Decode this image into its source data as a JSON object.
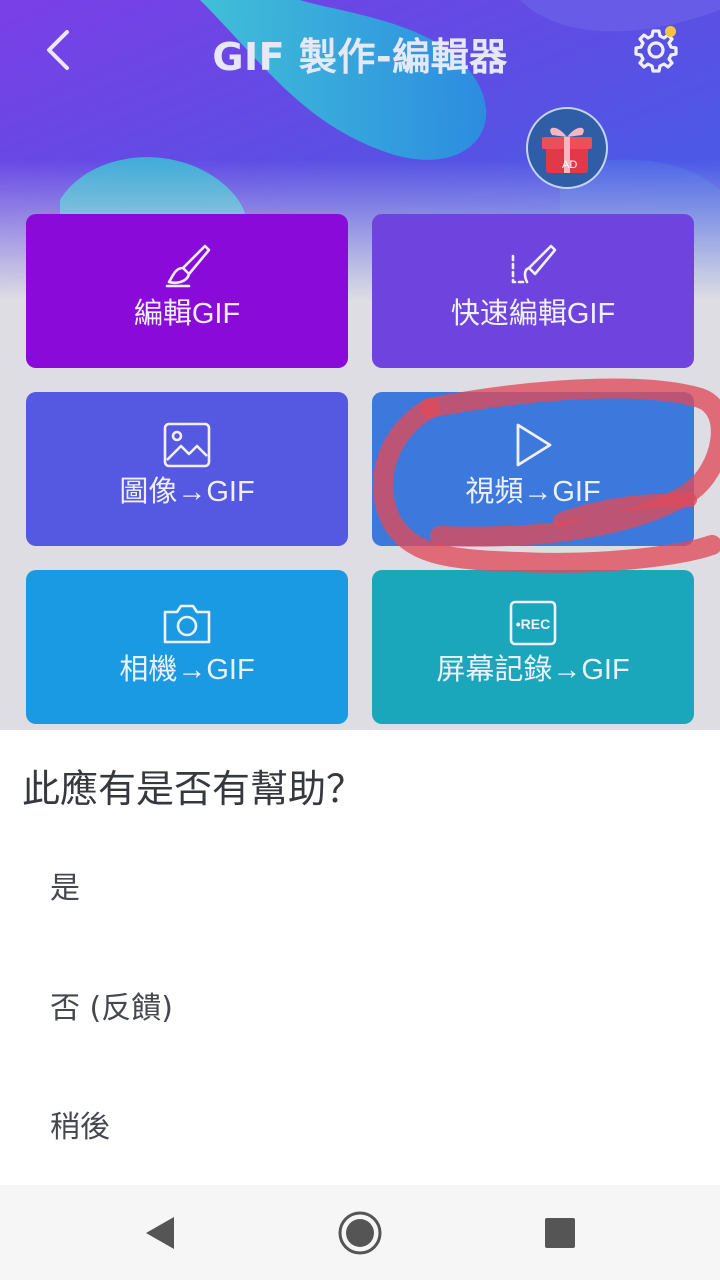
{
  "header": {
    "title": "GIF 製作-編輯器",
    "back_icon": "chevron-left-icon",
    "settings_icon": "gear-icon",
    "ad_icon": "gift-box-icon",
    "ad_badge": "AD"
  },
  "tiles": [
    {
      "label": "編輯GIF",
      "icon": "brush-icon",
      "color": "#8a0ad9"
    },
    {
      "label": "快速編輯GIF",
      "icon": "quick-brush-icon",
      "color": "#6f44de"
    },
    {
      "label": "圖像→GIF",
      "icon": "image-icon",
      "color": "#5558e0"
    },
    {
      "label": "視頻→GIF",
      "icon": "play-icon",
      "color": "#3d78dc"
    },
    {
      "label": "相機→GIF",
      "icon": "camera-icon",
      "color": "#1a9ae3"
    },
    {
      "label": "屏幕記錄→GIF",
      "icon": "rec-icon",
      "color": "#1aa6bb"
    }
  ],
  "rec_text": "•REC",
  "dialog": {
    "title": "此應有是否有幫助？",
    "options": [
      "是",
      "否 (反饋)",
      "稍後"
    ]
  },
  "navbar": {
    "back_icon": "nav-back-icon",
    "home_icon": "nav-home-icon",
    "recents_icon": "nav-recents-icon"
  },
  "colors": {
    "annotation_scribble": "#e04a5a",
    "dialog_bg": "#ffffff"
  }
}
